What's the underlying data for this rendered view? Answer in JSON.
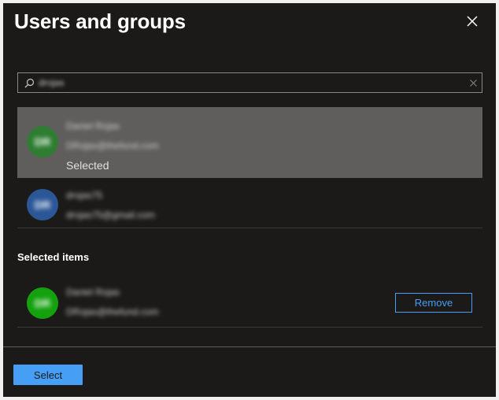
{
  "dialog": {
    "title": "Users and groups",
    "close_icon": "close-icon"
  },
  "search": {
    "value": "drojas",
    "search_icon": "search-icon",
    "clear_icon": "clear-icon"
  },
  "results": [
    {
      "name": "Daniel Rojas",
      "email": "DRojas@thefund.com",
      "initials": "DR",
      "status": "Selected",
      "avatar_color": "#2e7d32",
      "highlighted": true
    },
    {
      "name": "drojas75",
      "email": "drojas75@gmail.com",
      "initials": "DR",
      "status": "",
      "avatar_color": "#2b5797",
      "highlighted": false
    }
  ],
  "selected_section": {
    "label": "Selected items",
    "items": [
      {
        "name": "Daniel Rojas",
        "email": "DRojas@thefund.com",
        "initials": "DR",
        "avatar_color": "#13a10e",
        "remove_label": "Remove"
      }
    ]
  },
  "footer": {
    "select_label": "Select"
  },
  "colors": {
    "background": "#1b1a19",
    "accent": "#479ef5",
    "highlight": "#605e5c"
  }
}
